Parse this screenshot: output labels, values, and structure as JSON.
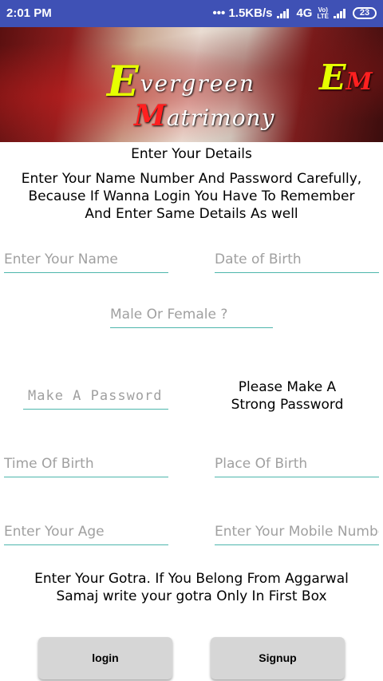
{
  "status_bar": {
    "time": "2:01 PM",
    "network_speed": "••• 1.5KB/s",
    "network_type": "4G",
    "volte_top": "Vo)",
    "volte_bottom": "LTE",
    "battery": "23"
  },
  "banner": {
    "evergreen_cap": "E",
    "evergreen_rest": "vergreen",
    "matrimony_cap": "M",
    "matrimony_rest": "atrimony",
    "badge_e": "E",
    "badge_m": "M",
    "colors": {
      "yellow": "#e6ff00",
      "red": "#ff2020"
    }
  },
  "form": {
    "heading": "Enter Your Details",
    "intro": "Enter Your Name Number And Password Carefully, Because If Wanna Login You Have To Remember And Enter Same Details As well",
    "name_placeholder": "Enter Your Name",
    "dob_placeholder": "Date of Birth",
    "gender_placeholder": "Male Or Female ?",
    "password_placeholder": "Make A Password",
    "password_note": "Please Make A Strong Password",
    "tob_placeholder": "Time Of Birth",
    "pob_placeholder": "Place Of Birth",
    "age_placeholder": "Enter Your Age",
    "mobile_placeholder": "Enter Your Mobile Number",
    "gotra_note": "Enter Your Gotra. If You Belong From Aggarwal Samaj write your gotra Only In First Box"
  },
  "buttons": {
    "login": "login",
    "signup": "Signup"
  },
  "colors": {
    "status_bar": "#3f51b5",
    "underline": "#4db6ac",
    "button": "#d6d6d6"
  }
}
